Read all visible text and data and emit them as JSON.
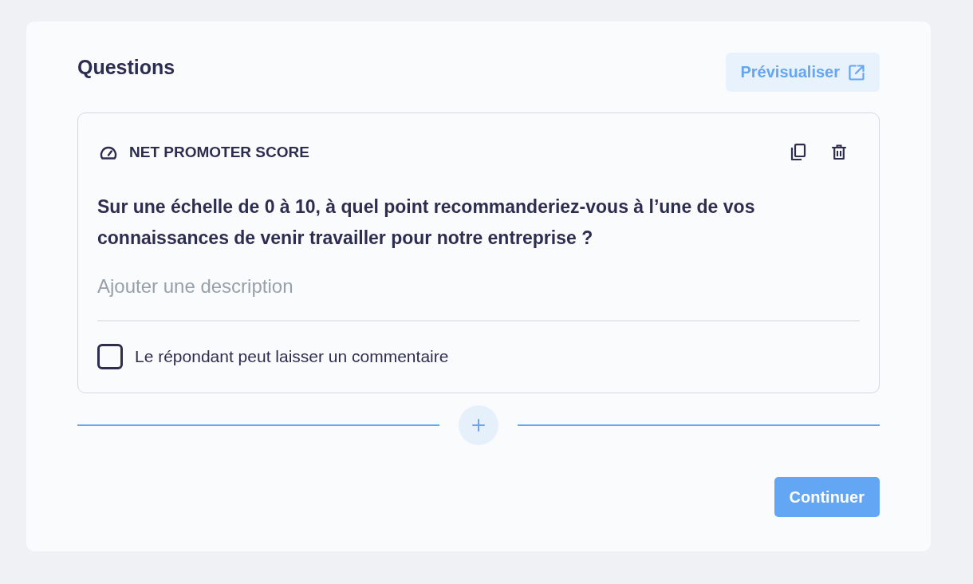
{
  "title": "Questions",
  "preview_button": {
    "label": "Prévisualiser"
  },
  "question": {
    "type_label": "NET PROMOTER SCORE",
    "text": "Sur une échelle de 0 à 10, à quel point recommanderiez-vous à l’une de vos connaissances de venir travailler pour notre entreprise ?",
    "description": {
      "placeholder": "Ajouter une description"
    },
    "comment_option": {
      "label": "Le répondant peut laisser un commentaire",
      "checked": false
    }
  },
  "continue_button": {
    "label": "Continuer"
  }
}
